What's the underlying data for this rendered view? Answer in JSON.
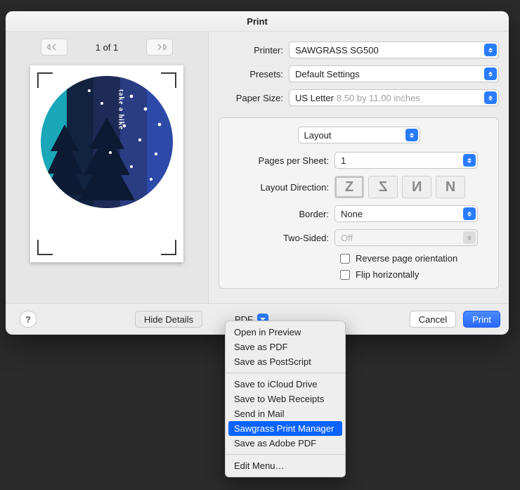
{
  "window": {
    "title": "Print"
  },
  "pager": {
    "counter": "1 of 1"
  },
  "printer": {
    "label": "Printer:",
    "value": "SAWGRASS SG500"
  },
  "presets": {
    "label": "Presets:",
    "value": "Default Settings"
  },
  "paper_size": {
    "label": "Paper Size:",
    "value": "US Letter",
    "detail": "8.50 by 11.00 inches"
  },
  "panel_selector": {
    "value": "Layout"
  },
  "layout": {
    "pages_per_sheet": {
      "label": "Pages per Sheet:",
      "value": "1"
    },
    "layout_direction": {
      "label": "Layout Direction:"
    },
    "border": {
      "label": "Border:",
      "value": "None"
    },
    "two_sided": {
      "label": "Two-Sided:",
      "value": "Off"
    },
    "reverse_orientation": {
      "label": "Reverse page orientation"
    },
    "flip_horizontally": {
      "label": "Flip horizontally"
    }
  },
  "footer": {
    "hide_details": "Hide Details",
    "pdf": "PDF",
    "cancel": "Cancel",
    "print": "Print"
  },
  "pdf_menu": {
    "open_preview": "Open in Preview",
    "save_pdf": "Save as PDF",
    "save_ps": "Save as PostScript",
    "icloud": "Save to iCloud Drive",
    "web_receipts": "Save to Web Receipts",
    "send_mail": "Send in Mail",
    "sawgrass": "Sawgrass Print Manager",
    "save_adobe": "Save as Adobe PDF",
    "edit_menu": "Edit Menu…"
  },
  "artwork": {
    "text": "take a hike"
  }
}
